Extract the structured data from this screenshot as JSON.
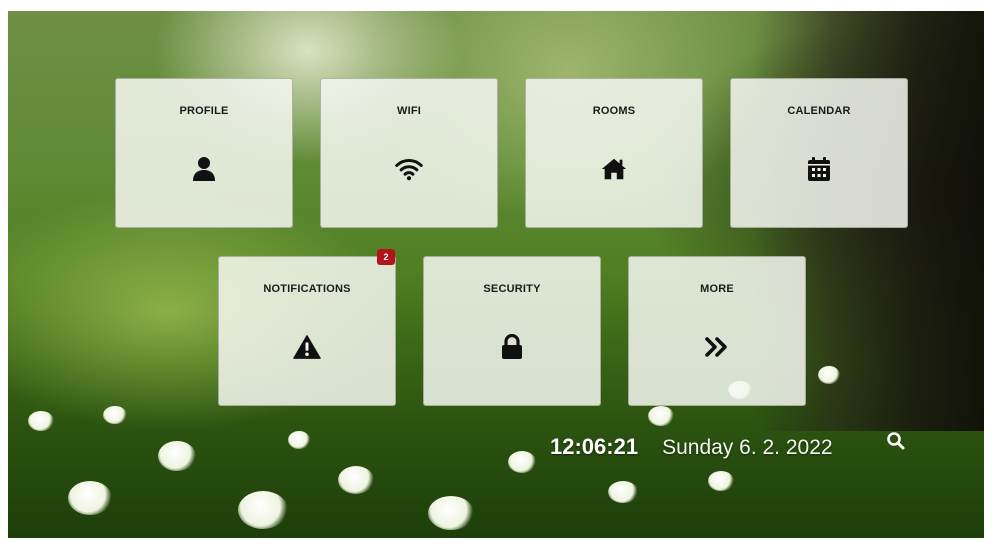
{
  "tiles": {
    "profile": {
      "label": "PROFILE",
      "icon": "user-icon"
    },
    "wifi": {
      "label": "WIFI",
      "icon": "wifi-icon"
    },
    "rooms": {
      "label": "ROOMS",
      "icon": "home-icon"
    },
    "calendar": {
      "label": "CALENDAR",
      "icon": "calendar-icon"
    },
    "notifications": {
      "label": "NOTIFICATIONS",
      "icon": "warning-icon",
      "badge": "2"
    },
    "security": {
      "label": "SECURITY",
      "icon": "lock-icon"
    },
    "more": {
      "label": "MORE",
      "icon": "double-chevron-right-icon"
    }
  },
  "status": {
    "time": "12:06:21",
    "date": "Sunday 6. 2. 2022",
    "search_icon": "search-icon"
  },
  "colors": {
    "tile_background": "#f4f7f0",
    "badge": "#b3141b",
    "icon": "#111111",
    "status_text": "#ffffff"
  }
}
